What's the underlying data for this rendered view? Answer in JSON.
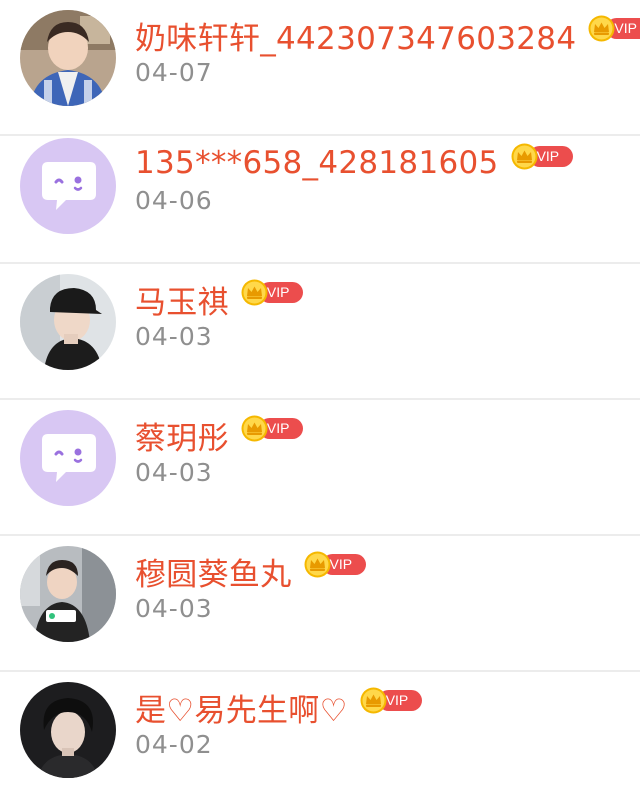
{
  "users": [
    {
      "name": "奶味轩轩_442307347603284",
      "date": "04-07",
      "vip": "VIP",
      "avatar": "photo-avatar-boy-jacket-icon"
    },
    {
      "name": "135***658_428181605",
      "date": "04-06",
      "vip": "VIP",
      "avatar": "default-chat-bubble-avatar-icon"
    },
    {
      "name": "马玉祺",
      "date": "04-03",
      "vip": "VIP",
      "avatar": "photo-avatar-cap-icon"
    },
    {
      "name": "蔡玥彤",
      "date": "04-03",
      "vip": "VIP",
      "avatar": "default-chat-bubble-avatar-icon"
    },
    {
      "name": "穆圆葵鱼丸",
      "date": "04-03",
      "vip": "VIP",
      "avatar": "photo-avatar-qqmusic-icon"
    },
    {
      "name": "是♡易先生啊♡",
      "date": "04-02",
      "vip": "VIP",
      "avatar": "photo-avatar-dark-hair-icon"
    }
  ],
  "colors": {
    "username": "#e8502f",
    "date": "#8f8f8f",
    "vip_pill": "#ec4d4d",
    "crown": "#f5b800",
    "default_avatar_bg": "#d8c7f3",
    "default_avatar_fg": "#9a71df"
  }
}
